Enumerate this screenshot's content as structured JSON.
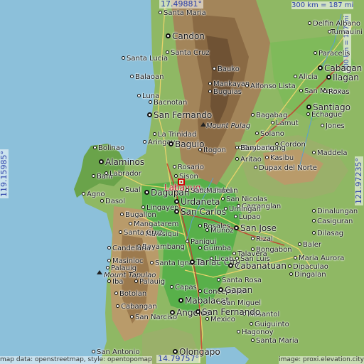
{
  "map": {
    "target": {
      "name": "Labayug"
    },
    "coordinates": {
      "top": "17.49881°",
      "bottom": "14.79757°",
      "left": "119.15985°",
      "right": "121.97235°"
    },
    "scale": {
      "horizontal": "300 km = 187 mi",
      "vertical": "300 km = 187 mi"
    },
    "attribution": {
      "left": "map data: openstreetmap, style: opentopomap",
      "right": "image: proxi.elevation.city"
    },
    "peaks": [
      "Mount Pulag",
      "Mount Tapulao"
    ],
    "places": [
      "Santa Maria",
      "Delfin Albano",
      "Tumauini",
      "Candon",
      "Paracelis",
      "Santa Lucia",
      "Santa Cruz",
      "Bauko",
      "Cabagan",
      "Ilagan",
      "Alicia",
      "Balaoan",
      "Mankayan",
      "Buguias",
      "Alfonso Lista",
      "San Mateo",
      "Roxas",
      "Luna",
      "Bacnotan",
      "Santiago",
      "San Fernando",
      "Echague",
      "Bagabag",
      "Lamut",
      "Jones",
      "Solano",
      "Cordon",
      "Bayombong",
      "Aringay",
      "La Trinidad",
      "Baguio",
      "Itogon",
      "Aritao",
      "Bambang",
      "Kasibu",
      "Maddela",
      "Bolinao",
      "Alaminos",
      "Rosario",
      "Dupax del Norte",
      "Bani",
      "Labrador",
      "Sison",
      "San Fabian",
      "Agno",
      "Sual",
      "Dagupan",
      "San Manuel",
      "San Nicolas",
      "Dasol",
      "Lingayen",
      "Urdaneta",
      "San Carlos",
      "Carranglan",
      "Dinalungan",
      "Bugallon",
      "Umingan",
      "Lupao",
      "Casiguran",
      "Mangatarem",
      "Malasiqui",
      "Rosales",
      "San Jose",
      "Dilasag",
      "Bayambang",
      "Santa Cruz",
      "Candelaria",
      "Paniqui",
      "Muñoz",
      "Rizal",
      "Baler",
      "Palauig",
      "Guimba",
      "Bongabon",
      "San Luis",
      "Masinloc",
      "Santa Ignacia",
      "Tarlac City",
      "Cabanatuan",
      "Licab",
      "Talavera",
      "Maria Aurora",
      "Iba",
      "Dipaculao",
      "Palauig",
      "Capas",
      "Santa Rosa",
      "Dingalan",
      "Botolan",
      "Concepcion",
      "Gapan",
      "Mabalacat",
      "Cabangan",
      "Angeles",
      "San Miguel",
      "Masantol",
      "San Narciso",
      "San Fernando",
      "Mexico",
      "Guiguinto",
      "Hagonoy",
      "Olongapo",
      "Santa Maria",
      "San Antonio"
    ]
  }
}
